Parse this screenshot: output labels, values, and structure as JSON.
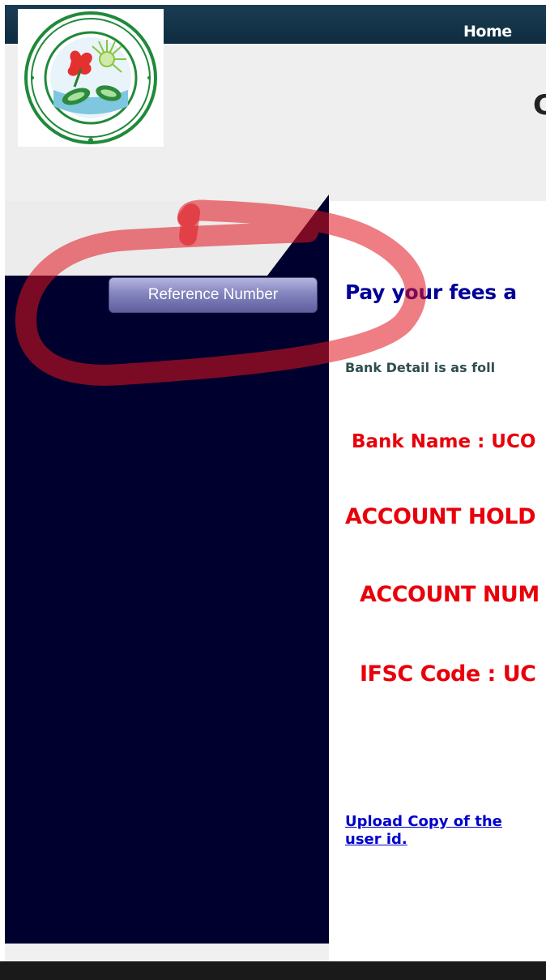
{
  "nav": {
    "home_label": "Home"
  },
  "header": {
    "title_fragment": "C"
  },
  "sidebar": {
    "reference_button_label": "Reference Number"
  },
  "content": {
    "heading": "Pay your fees a",
    "bank_detail_intro": "Bank Detail is as foll",
    "bank_name_line": "Bank Name : UCO",
    "account_holder_line": "ACCOUNT HOLD",
    "account_number_line": "ACCOUNT NUM",
    "ifsc_line": "IFSC Code : UC",
    "upload_link_line1": "Upload Copy of the",
    "upload_link_line2": "user id."
  },
  "colors": {
    "sidebar_bg": "#00002e",
    "nav_bg": "#1a3c52",
    "heading_blue": "#000099",
    "bank_red": "#e8000b",
    "annotation_red": "#e0141e"
  },
  "icons": {
    "logo": "college-seal-logo-icon"
  }
}
